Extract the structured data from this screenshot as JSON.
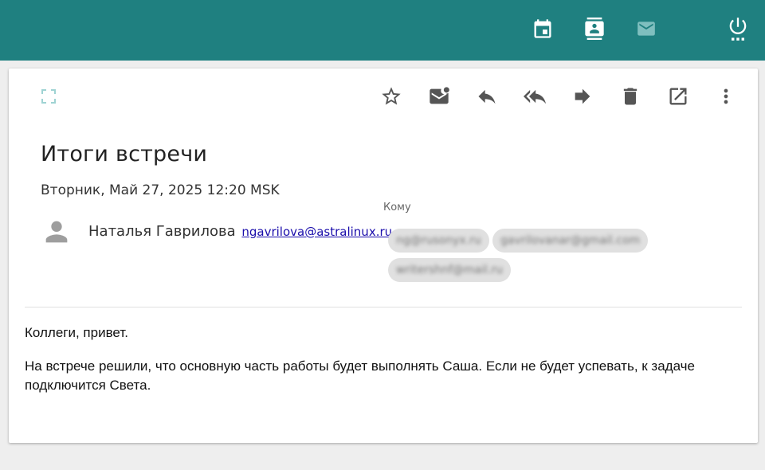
{
  "topbar": {
    "icons": [
      "calendar-icon",
      "contacts-icon",
      "mail-icon",
      "power-icon"
    ],
    "colors": {
      "background": "#1f8080",
      "icon": "#ffffff",
      "icon_dim": "#7fbfbf"
    }
  },
  "toolbar": {
    "icons": [
      "fullscreen-icon",
      "star-icon",
      "mark-unread-icon",
      "reply-icon",
      "reply-all-icon",
      "forward-icon",
      "delete-icon",
      "open-external-icon",
      "more-vert-icon"
    ]
  },
  "message": {
    "subject": "Итоги встречи",
    "date": "Вторник, Май 27, 2025 12:20 MSK",
    "sender_name": "Наталья Гаврилова",
    "sender_email": "ngavrilova@astralinux.ru",
    "to_label": "Кому",
    "recipients": [
      "ng@rusonyx.ru",
      "gavrilovanar@gmail.com",
      "writershnf@mail.ru"
    ],
    "body": [
      "Коллеги, привет.",
      "На встрече решили, что основную часть работы будет выполнять Саша. Если не будет успевать, к задаче подключится Света."
    ]
  }
}
